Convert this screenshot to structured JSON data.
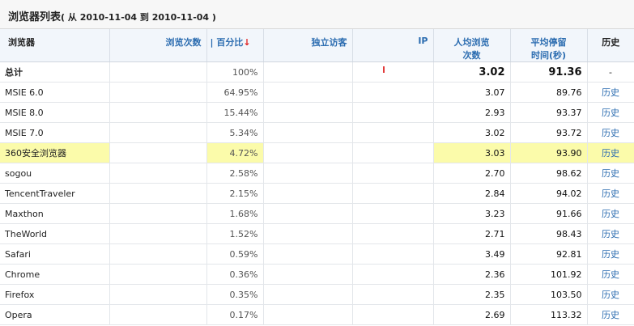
{
  "title": {
    "main": "浏览器列表",
    "sub": "( 从 2010-11-04 到 2010-11-04 )"
  },
  "headers": {
    "browser": "浏览器",
    "visits": "浏览次数",
    "percent": "| 百分比",
    "percent_arrow": "↓",
    "unique": "独立访客",
    "ip": "IP",
    "per_person_line1": "人均浏览",
    "per_person_line2": "次数",
    "avg_time_line1": "平均停留",
    "avg_time_line2": "时间(秒)",
    "history": "历史"
  },
  "rows": [
    {
      "name": "总计",
      "percent": "100%",
      "per_person": "3.02",
      "avg_time": "91.36",
      "history": "-"
    },
    {
      "name": "MSIE 6.0",
      "percent": "64.95%",
      "per_person": "3.07",
      "avg_time": "89.76",
      "history": "历史"
    },
    {
      "name": "MSIE 8.0",
      "percent": "15.44%",
      "per_person": "2.93",
      "avg_time": "93.37",
      "history": "历史"
    },
    {
      "name": "MSIE 7.0",
      "percent": "5.34%",
      "per_person": "3.02",
      "avg_time": "93.72",
      "history": "历史"
    },
    {
      "name": "360安全浏览器",
      "percent": "4.72%",
      "per_person": "3.03",
      "avg_time": "93.90",
      "history": "历史"
    },
    {
      "name": "sogou",
      "percent": "2.58%",
      "per_person": "2.70",
      "avg_time": "98.62",
      "history": "历史"
    },
    {
      "name": "TencentTraveler",
      "percent": "2.15%",
      "per_person": "2.84",
      "avg_time": "94.02",
      "history": "历史"
    },
    {
      "name": "Maxthon",
      "percent": "1.68%",
      "per_person": "3.23",
      "avg_time": "91.66",
      "history": "历史"
    },
    {
      "name": "TheWorld",
      "percent": "1.52%",
      "per_person": "2.71",
      "avg_time": "98.43",
      "history": "历史"
    },
    {
      "name": "Safari",
      "percent": "0.59%",
      "per_person": "3.49",
      "avg_time": "92.81",
      "history": "历史"
    },
    {
      "name": "Chrome",
      "percent": "0.36%",
      "per_person": "2.36",
      "avg_time": "101.92",
      "history": "历史"
    },
    {
      "name": "Firefox",
      "percent": "0.35%",
      "per_person": "2.35",
      "avg_time": "103.50",
      "history": "历史"
    },
    {
      "name": "Opera",
      "percent": "0.17%",
      "per_person": "2.69",
      "avg_time": "113.32",
      "history": "历史"
    }
  ],
  "colors": {
    "highlight_row": "#fbfbaa",
    "header_bg": "#f2f6fb",
    "link_blue": "#2b6cb0",
    "sort_arrow": "#e02020"
  }
}
